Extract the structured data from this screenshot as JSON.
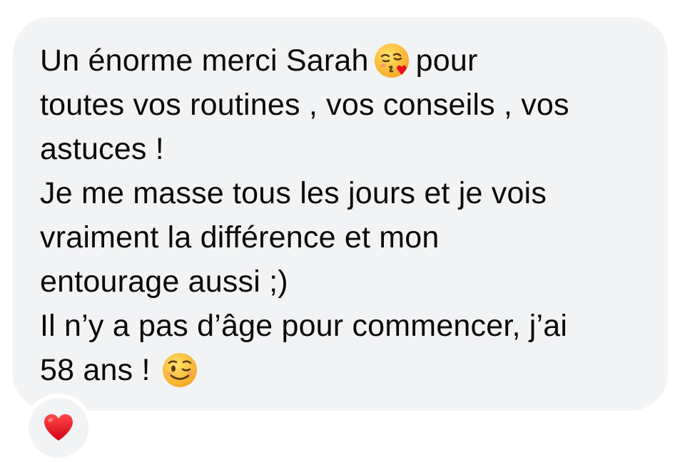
{
  "message": {
    "lines": [
      {
        "before": "Un énorme merci Sarah",
        "emoji": "kissing-face-with-heart-icon",
        "after": "pour"
      },
      {
        "text": "toutes vos routines , vos conseils , vos"
      },
      {
        "text": "astuces !"
      },
      {
        "text": "Je me masse tous les jours et je vois"
      },
      {
        "text": "vraiment la différence et mon"
      },
      {
        "text": "entourage aussi ;)"
      },
      {
        "text": "Il n’y a pas d’âge pour commencer, j’ai"
      },
      {
        "before": "58 ans !",
        "emoji": "winking-face-icon"
      }
    ]
  },
  "reaction": {
    "icon": "red-heart-icon",
    "color": "#e8121f"
  },
  "colors": {
    "bubble_background": "#f2f3f5",
    "text": "#0a0a0a",
    "emoji_yellow": "#fcc21b"
  }
}
